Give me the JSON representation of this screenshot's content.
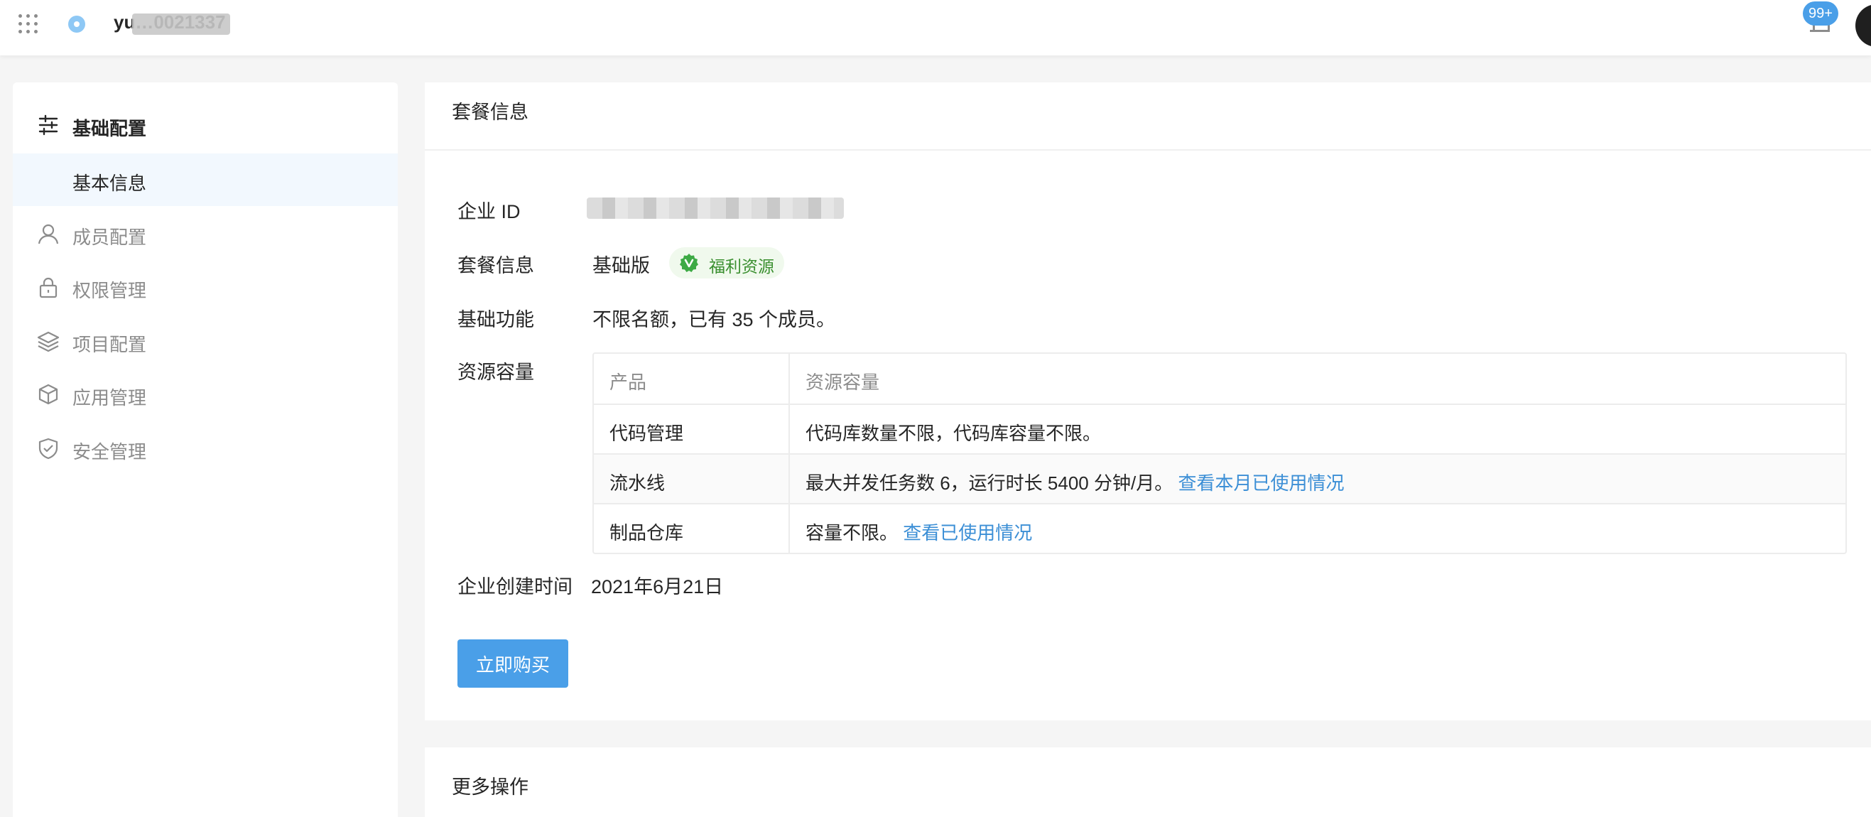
{
  "topbar": {
    "org_name": "yu…0021337",
    "notification_badge": "99+"
  },
  "sidebar": {
    "group_title": "基础配置",
    "items": [
      {
        "label": "基本信息",
        "icon": "none",
        "active": true
      },
      {
        "label": "成员配置",
        "icon": "user-icon",
        "active": false
      },
      {
        "label": "权限管理",
        "icon": "lock-icon",
        "active": false
      },
      {
        "label": "项目配置",
        "icon": "layers-icon",
        "active": false
      },
      {
        "label": "应用管理",
        "icon": "cube-icon",
        "active": false
      },
      {
        "label": "安全管理",
        "icon": "shield-check-icon",
        "active": false
      }
    ]
  },
  "package_card": {
    "title": "套餐信息",
    "fields": {
      "org_id_label": "企业 ID",
      "plan_label": "套餐信息",
      "plan_value": "基础版",
      "plan_tag": "福利资源",
      "basic_label": "基础功能",
      "basic_value": "不限名额，已有 35 个成员。",
      "resource_label": "资源容量",
      "created_label": "企业创建时间",
      "created_value": "2021年6月21日"
    },
    "resource_table": {
      "headers": [
        "产品",
        "资源容量"
      ],
      "rows": [
        {
          "product": "代码管理",
          "capacity": "代码库数量不限，代码库容量不限。",
          "link": ""
        },
        {
          "product": "流水线",
          "capacity": "最大并发任务数 6，运行时长 5400 分钟/月。",
          "link": "查看本月已使用情况"
        },
        {
          "product": "制品仓库",
          "capacity": "容量不限。",
          "link": "查看已使用情况"
        }
      ]
    },
    "buy_button": "立即购买"
  },
  "more_card": {
    "title": "更多操作"
  },
  "colors": {
    "accent": "#4a9fe8",
    "link": "#3c8fd6",
    "tag_bg": "#f0f9ed",
    "tag_text": "#3a8f2f",
    "active_item_bg": "#f2f8fe"
  }
}
